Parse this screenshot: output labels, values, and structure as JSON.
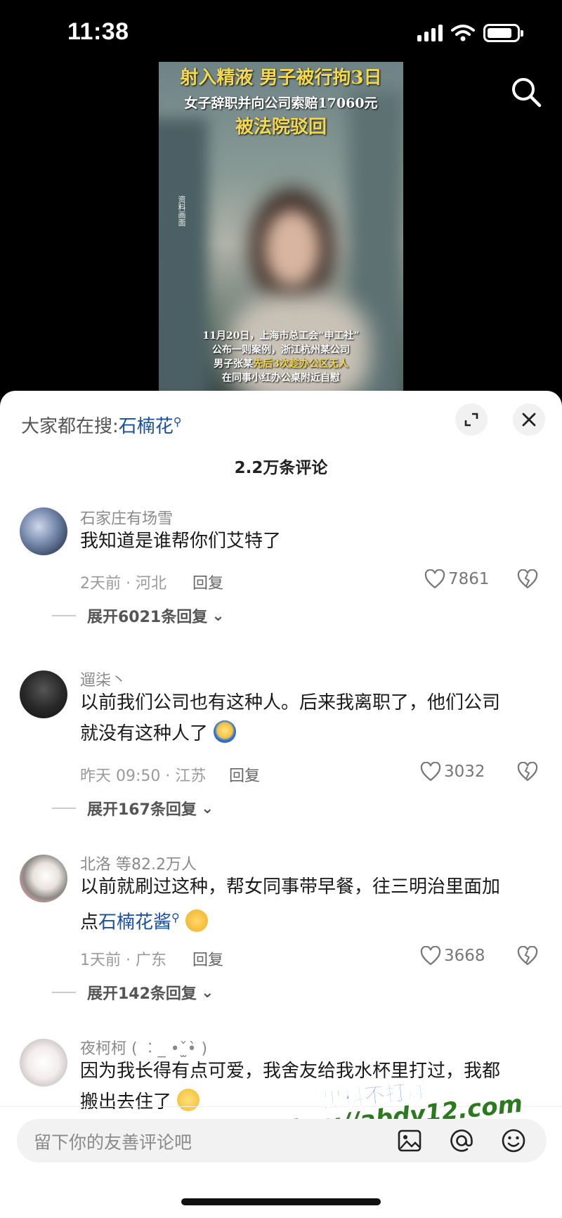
{
  "status_bar": {
    "time": "11:38"
  },
  "video": {
    "headline_1": "射入精液 男子被行拘3日",
    "headline_2": "女子辞职并向公司索赔17060元",
    "headline_3": "被法院驳回",
    "source_tag": "资料画面",
    "caption_line1": "11月20日，上海市总工会“申工社”",
    "caption_line2": "公布一则案例，浙江杭州某公司",
    "caption_line3_a": "男子张某",
    "caption_line3_b": "先后3次趁办公区无人",
    "caption_line4": "在同事小红办公桌附近自慰"
  },
  "sheet": {
    "search_prefix": "大家都在搜:",
    "search_keyword": "石楠花",
    "comment_count": "2.2万条评论"
  },
  "comments": [
    {
      "author": "石家庄有场雪",
      "text": "我知道是谁帮你们艾特了",
      "meta": "2天前 · 河北",
      "reply": "回复",
      "likes": "7861",
      "expand": "展开6021条回复"
    },
    {
      "author": "遛柒丶",
      "text_line1": "以前我们公司也有这种人。后来我离职了，他们公司",
      "text_line2": "就没有这种人了",
      "meta": "昨天 09:50 · 江苏",
      "reply": "回复",
      "likes": "3032",
      "expand": "展开167条回复"
    },
    {
      "author": "北洛 等82.2万人",
      "text_line1": "以前就刷过这种，帮女同事带早餐，往三明治里面加",
      "text_line2_a": "点",
      "text_line2_link": "石楠花酱",
      "meta": "1天前 · 广东",
      "reply": "回复",
      "likes": "3668",
      "expand": "展开142条回复"
    },
    {
      "author": "夜柯柯 ( ︰_ •ˇ̫•̀ )",
      "text_line1": "因为我长得有点可爱，我舍友给我水杯里打过，我都",
      "text_line2": "搬出去住了"
    }
  ],
  "input": {
    "placeholder": "留下你的友善评论吧"
  },
  "watermark": {
    "line1": "黑料不打烊",
    "line2": "https://abdy12.com"
  }
}
